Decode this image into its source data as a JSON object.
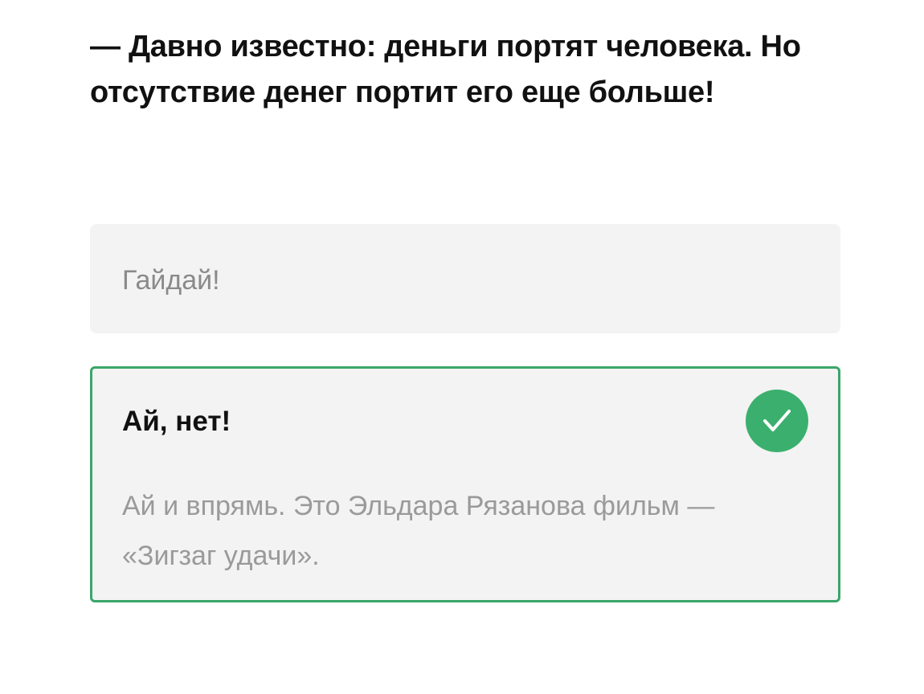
{
  "question": {
    "text": "— Давно известно: деньги портят человека. Но отсутствие денег портит его еще больше!"
  },
  "options": [
    {
      "label": "Гайдай!",
      "state": "unselected"
    },
    {
      "label": "Ай, нет!",
      "state": "correct",
      "icon": "checkmark-icon",
      "explanation": "Ай и впрямь. Это Эльдара Рязанова фильм — «Зигзаг удачи»."
    }
  ],
  "colors": {
    "correct_border": "#3aa66a",
    "correct_badge": "#3bb06e",
    "option_background": "#f3f3f3",
    "muted_text": "#8a8a8a"
  }
}
